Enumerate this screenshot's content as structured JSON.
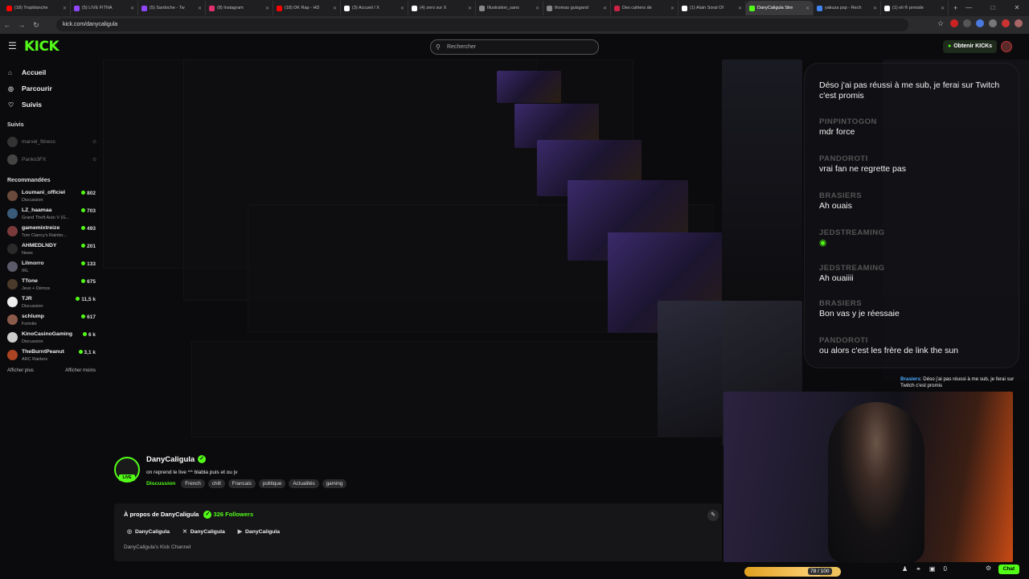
{
  "browser": {
    "tabs": [
      {
        "label": "(18) Tropblanche",
        "color": "#ff0000"
      },
      {
        "label": "(5) LIVE FITNA",
        "color": "#9146ff"
      },
      {
        "label": "(5) Sardoche - Tw",
        "color": "#9146ff"
      },
      {
        "label": "(8) Instagram",
        "color": "#e1306c"
      },
      {
        "label": "(18) DK Rap - HD",
        "color": "#ff0000"
      },
      {
        "label": "(3) Accueil / X",
        "color": "#ffffff"
      },
      {
        "label": "(4) zero sur X",
        "color": "#ffffff"
      },
      {
        "label": "Illustration_sans",
        "color": "#888888"
      },
      {
        "label": "thomas guisgand",
        "color": "#888888"
      },
      {
        "label": "Des cahiers de",
        "color": "#cc2244"
      },
      {
        "label": "(1) Alain Soral Of",
        "color": "#ffffff"
      },
      {
        "label": "DanyCaligula Stre",
        "color": "#53fc18",
        "active": true
      },
      {
        "label": "yakuza psp - Rech",
        "color": "#4285f4"
      },
      {
        "label": "(1) eli ® preside",
        "color": "#ffffff"
      }
    ],
    "url": "kick.com/danycaligula"
  },
  "header": {
    "logo": "KICK",
    "search_placeholder": "Rechercher",
    "kicks_button": "Obtenir KICKs"
  },
  "sidebar": {
    "nav": [
      {
        "label": "Accueil",
        "icon": "home-icon"
      },
      {
        "label": "Parcourir",
        "icon": "compass-icon"
      },
      {
        "label": "Suivis",
        "icon": "heart-icon"
      }
    ],
    "followed_title": "Suivis",
    "followed": [
      {
        "name": "marvel_fitness"
      },
      {
        "name": "Panko3FX"
      }
    ],
    "recommended_title": "Recommandées",
    "recommended": [
      {
        "name": "Loumani_officiel",
        "category": "Discussion",
        "viewers": "802",
        "color": "#6a4a3a"
      },
      {
        "name": "LZ_haamaa",
        "category": "Grand Theft Auto V (G...",
        "viewers": "703",
        "color": "#3a5a7a"
      },
      {
        "name": "gamemixtreize",
        "category": "Tom Clancy's Rainbo...",
        "viewers": "493",
        "color": "#7a3a3a"
      },
      {
        "name": "AHMEDLNDY",
        "category": "News",
        "viewers": "201",
        "color": "#2a2a2a"
      },
      {
        "name": "Lilmorro",
        "category": "IRL",
        "viewers": "133",
        "color": "#5a5a6a"
      },
      {
        "name": "TTone",
        "category": "Jeux + Démos",
        "viewers": "675",
        "color": "#4a3a2a"
      },
      {
        "name": "TJR",
        "category": "Discussion",
        "viewers": "11,5 k",
        "color": "#eeeeee"
      },
      {
        "name": "schlump",
        "category": "Fortnite",
        "viewers": "617",
        "color": "#8a5a4a"
      },
      {
        "name": "KinoCasinoGaming",
        "category": "Discussion",
        "viewers": "6 k",
        "color": "#cccccc"
      },
      {
        "name": "TheBurntPeanut",
        "category": "ARC Raiders",
        "viewers": "3,1 k",
        "color": "#aa4422"
      }
    ],
    "show_more": "Afficher plus",
    "show_less": "Afficher moins"
  },
  "channel": {
    "name": "DanyCaligula",
    "live_badge": "LIVE",
    "title": "on reprend le live ^^ blabla puis et ou jv",
    "category": "Discussion",
    "tags": [
      "French",
      "chill",
      "Francais",
      "politique",
      "Actualités",
      "gaming"
    ],
    "about_title": "À propos de DanyCaligula",
    "followers": "326 Followers",
    "links": [
      {
        "icon": "instagram-icon",
        "glyph": "◎",
        "label": "DanyCaligula"
      },
      {
        "icon": "x-icon",
        "glyph": "✕",
        "label": "DanyCaligula"
      },
      {
        "icon": "youtube-icon",
        "glyph": "▶",
        "label": "DanyCaligula"
      }
    ],
    "description": "DanyCaligula's Kick Channel"
  },
  "overlay_chat": [
    {
      "user": "",
      "text": "Déso j'ai pas réussi à me sub, je ferai sur Twitch c'est promis"
    },
    {
      "user": "PINPINTOGON",
      "text": "mdr force"
    },
    {
      "user": "PANDOROTI",
      "text": "vrai fan ne regrette pas"
    },
    {
      "user": "BRASIERS",
      "text": "Ah ouais"
    },
    {
      "user": "JEDSTREAMING",
      "text": ""
    },
    {
      "user": "JEDSTREAMING",
      "text": "Ah ouaiiii"
    },
    {
      "user": "BRASIERS",
      "text": "Bon vas y je réessaie"
    },
    {
      "user": "PANDOROTI",
      "text": "ou alors c'est les frère de link the sun"
    }
  ],
  "mini_chat": {
    "user": "Brasiers",
    "text": ": Déso j'ai pas réussi à me sub, je ferai sur Twitch c'est promis"
  },
  "bottom": {
    "progress": "78 / 100",
    "progress_fraction": 0.78,
    "viewers": "0",
    "chat_button": "Chat"
  }
}
